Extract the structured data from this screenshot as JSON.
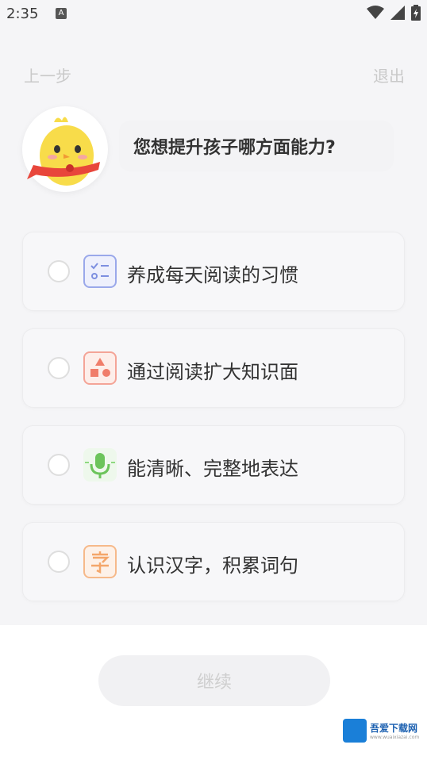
{
  "status_bar": {
    "time": "2:35",
    "notification_icon": "A"
  },
  "nav": {
    "back_label": "上一步",
    "exit_label": "退出"
  },
  "question": {
    "text": "您想提升孩子哪方面能力?"
  },
  "options": [
    {
      "label": "养成每天阅读的习惯",
      "icon": "checklist-icon",
      "color": "#7d8fe0"
    },
    {
      "label": "通过阅读扩大知识面",
      "icon": "shapes-icon",
      "color": "#f07d6a"
    },
    {
      "label": "能清晰、完整地表达",
      "icon": "microphone-icon",
      "color": "#6cc45b"
    },
    {
      "label": "认识汉字，积累词句",
      "icon": "character-icon",
      "color": "#f4a66a"
    }
  ],
  "continue_button": {
    "label": "继续"
  },
  "watermark": {
    "text": "吾爱下载网",
    "sub": "www.wuaixiazai.com"
  }
}
